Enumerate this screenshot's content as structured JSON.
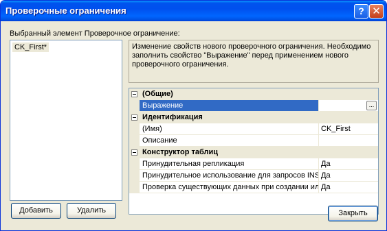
{
  "window": {
    "title": "Проверочные ограничения",
    "help_glyph": "?",
    "close_glyph": "✕"
  },
  "selected_label": "Выбранный элемент Проверочное ограничение:",
  "list": {
    "items": [
      "CK_First*"
    ]
  },
  "description": "Изменение свойств нового проверочного ограничения.  Необходимо заполнить свойство \"Выражение\" перед применением нового проверочного ограничения.",
  "properties": {
    "categories": [
      {
        "label": "(Общие)",
        "rows": [
          {
            "name": "Выражение",
            "value": "",
            "button": "..."
          }
        ]
      },
      {
        "label": "Идентификация",
        "rows": [
          {
            "name": "(Имя)",
            "value": "CK_First"
          },
          {
            "name": "Описание",
            "value": ""
          }
        ]
      },
      {
        "label": "Конструктор таблиц",
        "rows": [
          {
            "name": "Принудительная репликация",
            "value": "Да"
          },
          {
            "name": "Принудительное использование для запросов INS",
            "value": "Да"
          },
          {
            "name": "Проверка существующих данных при создании или",
            "value": "Да"
          }
        ]
      }
    ]
  },
  "buttons": {
    "add": "Добавить",
    "delete": "Удалить",
    "close": "Закрыть"
  },
  "colors": {
    "titlebar": "#0053ee",
    "selection": "#316ac5",
    "face": "#ece9d8"
  }
}
